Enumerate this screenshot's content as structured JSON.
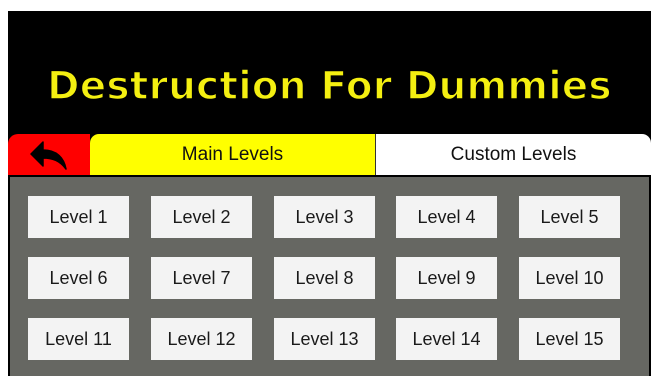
{
  "title": "Destruction For Dummies",
  "tabs": {
    "main_label": "Main Levels",
    "custom_label": "Custom Levels",
    "active": "Main Levels"
  },
  "back_button": {
    "icon": "back-arrow-icon"
  },
  "levels": [
    "Level 1",
    "Level 2",
    "Level 3",
    "Level 4",
    "Level 5",
    "Level 6",
    "Level 7",
    "Level 8",
    "Level 9",
    "Level 10",
    "Level 11",
    "Level 12",
    "Level 13",
    "Level 14",
    "Level 15"
  ],
  "colors": {
    "title": "#f4ef11",
    "back_button": "#ff0000",
    "active_tab": "#ffff00",
    "inactive_tab": "#ffffff",
    "panel": "#666762",
    "level_button": "#f3f3f3"
  }
}
